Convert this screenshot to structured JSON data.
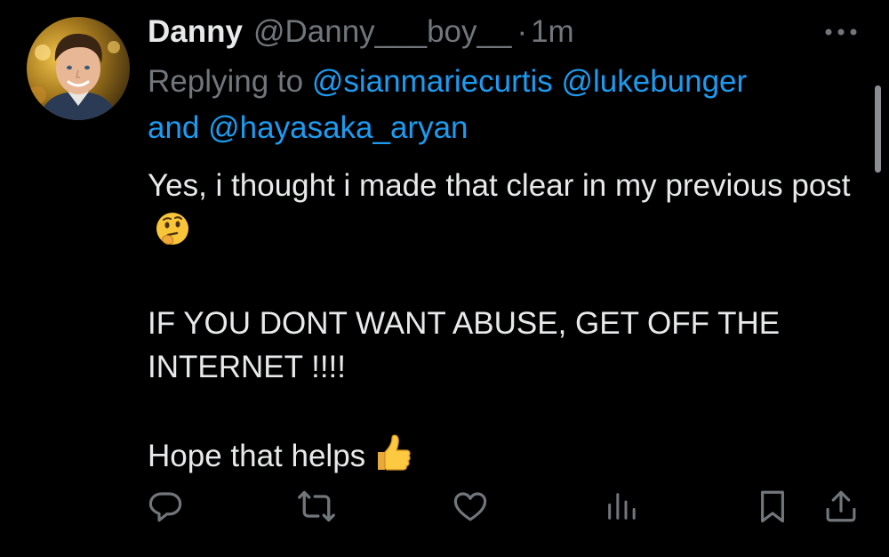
{
  "tweet": {
    "author_name": "Danny",
    "author_handle": "@Danny___boy__",
    "separator": "·",
    "time": "1m",
    "replying_prefix": "Replying to",
    "mentions": [
      "@sianmariecurtis",
      "@lukebunger",
      "@hayasaka_aryan"
    ],
    "mention_joiner": "and",
    "text_line1": "Yes, i thought i made that clear in my previous post",
    "text_line2": "IF YOU DONT WANT ABUSE, GET OFF THE INTERNET !!!!",
    "text_line3": "Hope that helps",
    "emoji_1": "thinking-face",
    "emoji_2": "thumbs-up"
  },
  "actions": [
    {
      "name": "reply",
      "icon": "reply-icon"
    },
    {
      "name": "retweet",
      "icon": "retweet-icon"
    },
    {
      "name": "like",
      "icon": "heart-icon"
    },
    {
      "name": "views",
      "icon": "bar-chart-icon"
    },
    {
      "name": "bookmark",
      "icon": "bookmark-icon"
    },
    {
      "name": "share",
      "icon": "share-icon"
    }
  ],
  "colors": {
    "background": "#000000",
    "text": "#e7e9ea",
    "muted": "#71767b",
    "link": "#1d9bf0",
    "icon": "#71767b"
  }
}
